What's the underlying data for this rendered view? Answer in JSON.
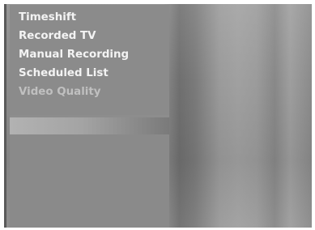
{
  "menu": {
    "items": [
      {
        "label": "Timeshift",
        "state": "normal"
      },
      {
        "label": "Recorded TV",
        "state": "normal"
      },
      {
        "label": "Manual Recording",
        "state": "normal"
      },
      {
        "label": "Scheduled List",
        "state": "normal"
      },
      {
        "label": "Video Quality",
        "state": "dimmed"
      }
    ]
  },
  "colors": {
    "panel": "#8b8b8b",
    "text": "#f3f3f3",
    "dim_text": "#c0c0c0",
    "highlight": "#a4a4a4"
  }
}
